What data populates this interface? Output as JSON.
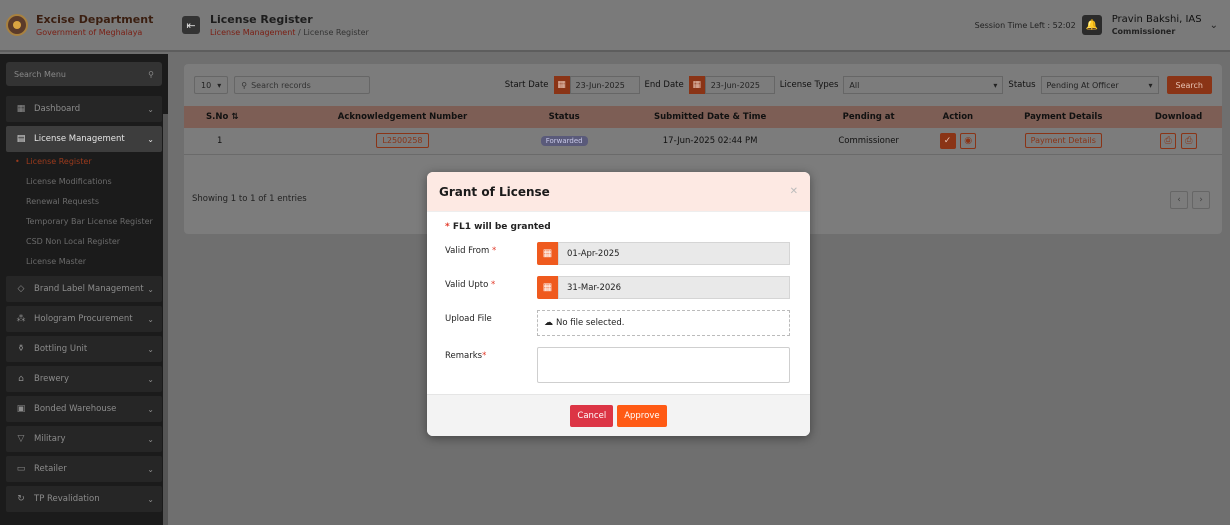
{
  "header": {
    "brand_title": "Excise Department",
    "brand_subtitle": "Government of Meghalaya",
    "page_title": "License Register",
    "breadcrumb_parent": "License Management",
    "breadcrumb_sep": "/",
    "breadcrumb_current": "License Register",
    "session_label": "Session Time Left : 52:02",
    "user_name": "Pravin Bakshi, IAS",
    "user_role": "Commissioner"
  },
  "sidebar": {
    "search_placeholder": "Search Menu",
    "items": [
      {
        "label": "Dashboard",
        "icon": "dashboard-icon"
      },
      {
        "label": "License Management",
        "icon": "license-icon"
      },
      {
        "label": "Brand Label Management",
        "icon": "tag-icon"
      },
      {
        "label": "Hologram Procurement",
        "icon": "hologram-icon"
      },
      {
        "label": "Bottling Unit",
        "icon": "bottle-icon"
      },
      {
        "label": "Brewery",
        "icon": "brewery-icon"
      },
      {
        "label": "Bonded Warehouse",
        "icon": "warehouse-icon"
      },
      {
        "label": "Military",
        "icon": "military-icon"
      },
      {
        "label": "Retailer",
        "icon": "retailer-icon"
      },
      {
        "label": "TP Revalidation",
        "icon": "revalidation-icon"
      }
    ],
    "sub_items": [
      "License Register",
      "License Modifications",
      "Renewal Requests",
      "Temporary Bar License Register",
      "CSD Non Local Register",
      "License Master"
    ]
  },
  "toolbar": {
    "page_size": "10",
    "search_placeholder": "Search records",
    "start_label": "Start Date",
    "start_value": "23-Jun-2025",
    "end_label": "End Date",
    "end_value": "23-Jun-2025",
    "types_label": "License Types",
    "types_value": "All",
    "status_label": "Status",
    "status_value": "Pending At Officer",
    "search_btn": "Search"
  },
  "table": {
    "headers": [
      "S.No",
      "Acknowledgement Number",
      "Status",
      "Submitted Date & Time",
      "Pending at",
      "Action",
      "Payment Details",
      "Download"
    ],
    "rows": [
      {
        "sno": "1",
        "ack": "L2500258",
        "status": "Forwarded",
        "submitted": "17-Jun-2025 02:44 PM",
        "pending": "Commissioner",
        "payment": "Payment Details"
      }
    ],
    "entries_text": "Showing 1 to 1 of 1 entries"
  },
  "modal": {
    "title": "Grant of License",
    "note": "FL1 will be granted",
    "valid_from_label": "Valid From",
    "valid_from_value": "01-Apr-2025",
    "valid_upto_label": "Valid Upto",
    "valid_upto_value": "31-Mar-2026",
    "upload_label": "Upload File",
    "upload_value": "No file selected.",
    "remarks_label": "Remarks",
    "cancel_btn": "Cancel",
    "approve_btn": "Approve"
  },
  "colors": {
    "accent": "#ff5a14",
    "cancel": "#dc3545",
    "modal_header": "#fde9e3"
  }
}
